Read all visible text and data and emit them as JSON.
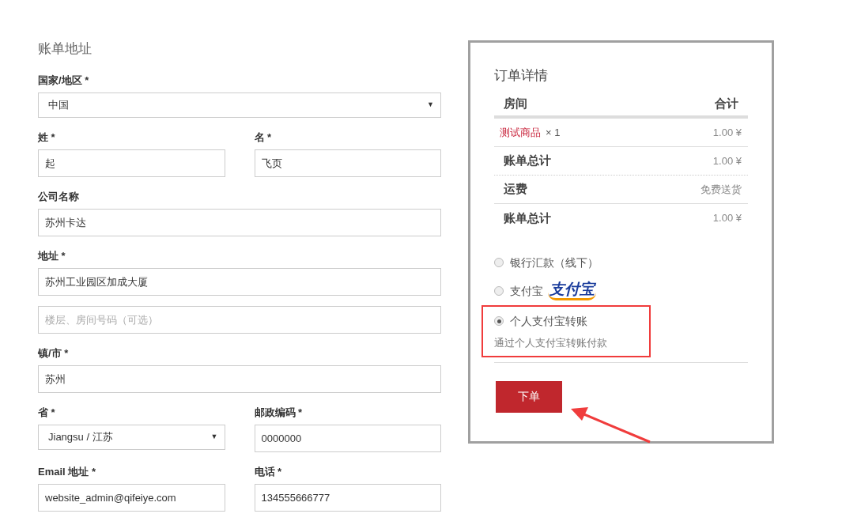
{
  "billing": {
    "title": "账单地址",
    "rows": [
      [
        {
          "label": "国家/地区 *",
          "inputs": [
            {
              "kind": "select",
              "value": "中国",
              "arrow": "▼"
            }
          ]
        }
      ],
      [
        {
          "label": "姓 *",
          "inputs": [
            {
              "kind": "input",
              "value": "起"
            }
          ]
        },
        {
          "label": "名 *",
          "inputs": [
            {
              "kind": "input",
              "value": "飞页"
            }
          ]
        }
      ],
      [
        {
          "label": "公司名称",
          "inputs": [
            {
              "kind": "input",
              "value": "苏州卡达"
            }
          ]
        }
      ],
      [
        {
          "label": "地址 *",
          "inputs": [
            {
              "kind": "input",
              "value": "苏州工业园区加成大厦"
            },
            {
              "kind": "input",
              "placeholder": "楼层、房间号码（可选）"
            }
          ]
        }
      ],
      [
        {
          "label": "镇/市 *",
          "inputs": [
            {
              "kind": "input",
              "value": "苏州"
            }
          ]
        }
      ],
      [
        {
          "label": "省 *",
          "inputs": [
            {
              "kind": "select",
              "value": "Jiangsu / 江苏",
              "arrow": "▼"
            }
          ]
        },
        {
          "label": "邮政编码 *",
          "inputs": [
            {
              "kind": "input",
              "value": "0000000"
            }
          ]
        }
      ],
      [
        {
          "label": "Email 地址 *",
          "inputs": [
            {
              "kind": "input",
              "value": "website_admin@qifeiye.com"
            }
          ]
        },
        {
          "label": "电话 *",
          "inputs": [
            {
              "kind": "input",
              "value": "134555666777"
            }
          ]
        }
      ]
    ]
  },
  "order": {
    "title": "订单详情",
    "columns": [
      "房间",
      "合计"
    ],
    "rows": [
      {
        "kind": "product",
        "name": "测试商品",
        "qty": "× 1",
        "value": "1.00 ¥"
      },
      {
        "kind": "total",
        "name": "账单总计",
        "value": "1.00 ¥"
      },
      {
        "kind": "total",
        "name": "运费",
        "value": "免费送货"
      },
      {
        "kind": "total",
        "name": "账单总计",
        "value": "1.00 ¥"
      }
    ],
    "payment_methods": [
      {
        "label": "银行汇款（线下）",
        "selected": false,
        "highlighted": false
      },
      {
        "label": "支付宝",
        "logo_text": "支付宝",
        "selected": false,
        "highlighted": false
      },
      {
        "label": "个人支付宝转账",
        "description": "通过个人支付宝转账付款",
        "selected": true,
        "highlighted": true
      }
    ],
    "button": "下单"
  }
}
